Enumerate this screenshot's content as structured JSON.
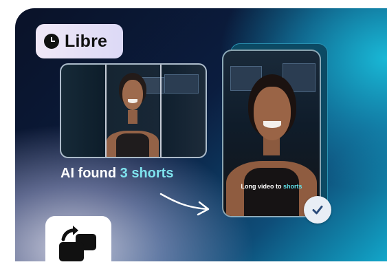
{
  "badge": {
    "label": "Libre",
    "icon": "clock-icon"
  },
  "headline": {
    "prefix": "AI found ",
    "highlight": "3 shorts"
  },
  "short_caption": {
    "prefix": "Long video to ",
    "highlight": "shorts"
  },
  "colors": {
    "accent_cyan": "#5fe0e8",
    "badge_bg": "#e6e1f6",
    "card_dark": "#0b1d3f"
  },
  "icons": {
    "check": "checkmark-icon",
    "arrow": "curved-arrow-icon",
    "app": "repurpose-app-icon"
  }
}
